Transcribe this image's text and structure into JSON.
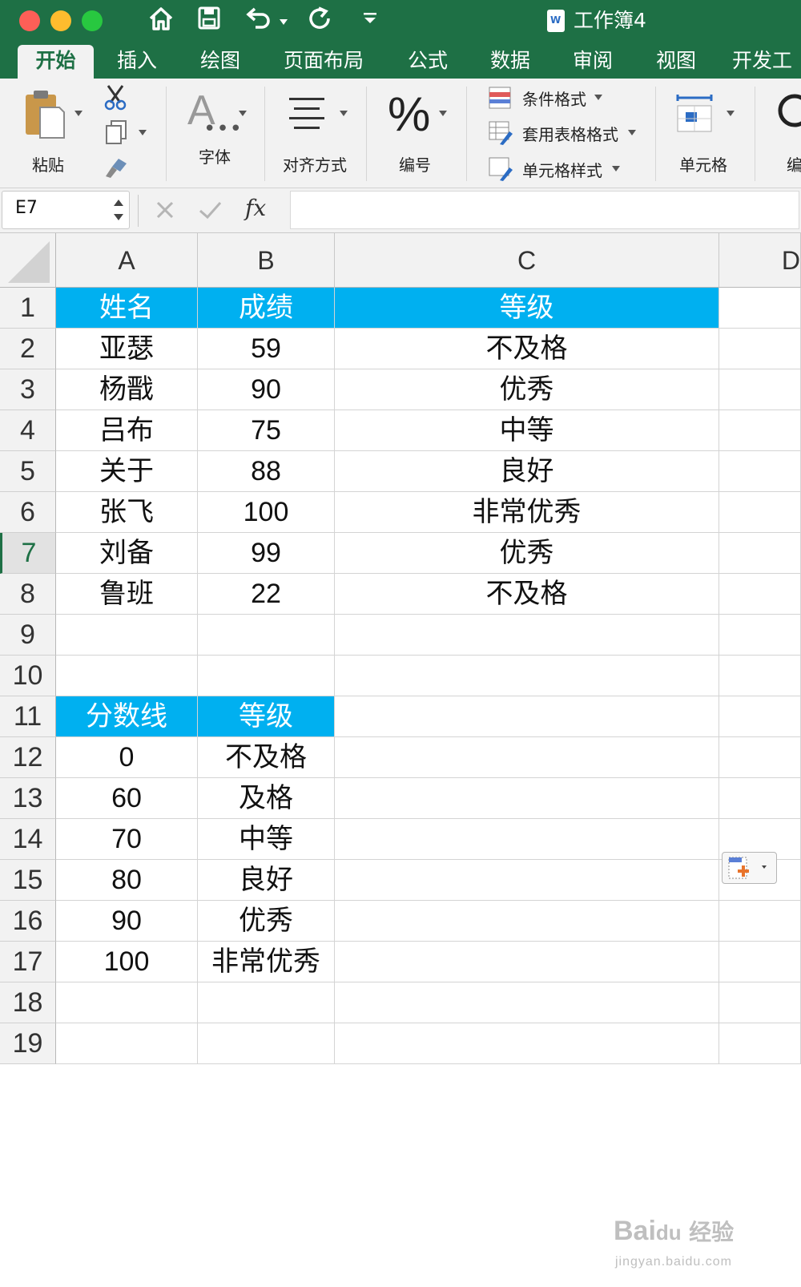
{
  "titlebar": {
    "title": "工作簿4"
  },
  "tabs": [
    "开始",
    "插入",
    "绘图",
    "页面布局",
    "公式",
    "数据",
    "审阅",
    "视图",
    "开发工"
  ],
  "ribbon": {
    "paste": "粘贴",
    "font": "字体",
    "align": "对齐方式",
    "number": "编号",
    "cond_format": "条件格式",
    "table_format": "套用表格格式",
    "cell_style": "单元格样式",
    "cells": "单元格",
    "edit_partial": "编"
  },
  "formula_bar": {
    "name_box": "E7",
    "fx": "fx",
    "formula": ""
  },
  "columns": [
    "A",
    "B",
    "C",
    "D"
  ],
  "rows": [
    "1",
    "2",
    "3",
    "4",
    "5",
    "6",
    "7",
    "8",
    "9",
    "10",
    "11",
    "12",
    "13",
    "14",
    "15",
    "16",
    "17",
    "18",
    "19"
  ],
  "selected_row": "7",
  "table1": {
    "headers": [
      "姓名",
      "成绩",
      "等级"
    ],
    "rows": [
      [
        "亚瑟",
        "59",
        "不及格"
      ],
      [
        "杨戬",
        "90",
        "优秀"
      ],
      [
        "吕布",
        "75",
        "中等"
      ],
      [
        "关于",
        "88",
        "良好"
      ],
      [
        "张飞",
        "100",
        "非常优秀"
      ],
      [
        "刘备",
        "99",
        "优秀"
      ],
      [
        "鲁班",
        "22",
        "不及格"
      ]
    ]
  },
  "table2": {
    "headers": [
      "分数线",
      "等级"
    ],
    "rows": [
      [
        "0",
        "不及格"
      ],
      [
        "60",
        "及格"
      ],
      [
        "70",
        "中等"
      ],
      [
        "80",
        "良好"
      ],
      [
        "90",
        "优秀"
      ],
      [
        "100",
        "非常优秀"
      ]
    ]
  },
  "colors": {
    "header_fill": "#00b0f0",
    "ribbon_green": "#1e7045"
  },
  "watermark": {
    "logo": "Baidu经验",
    "url": "jingyan.baidu.com"
  }
}
